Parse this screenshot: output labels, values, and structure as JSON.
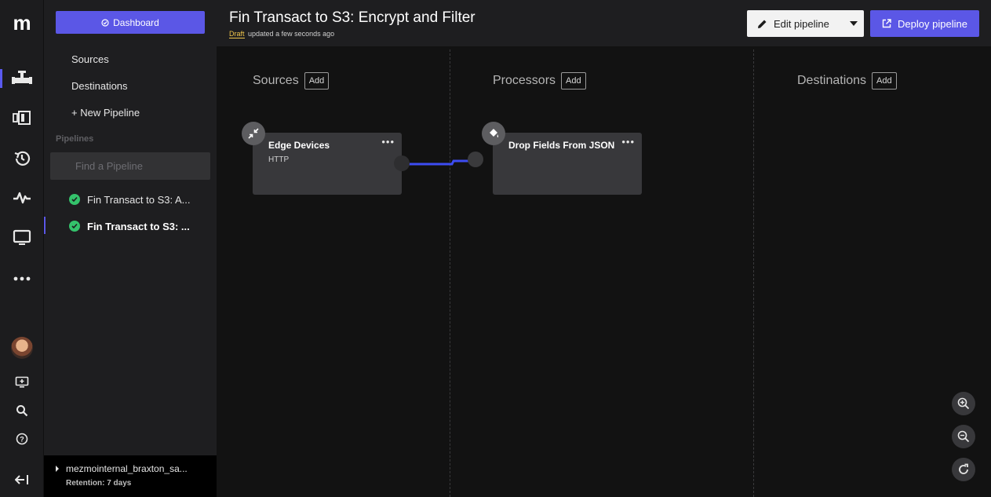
{
  "app": {
    "logo": "m"
  },
  "rail": {
    "items": [
      {
        "icon": "pipeline-icon",
        "active": true
      },
      {
        "icon": "columns-icon"
      },
      {
        "icon": "history-icon"
      },
      {
        "icon": "pulse-icon"
      },
      {
        "icon": "monitor-icon"
      },
      {
        "icon": "more-icon"
      }
    ],
    "bottom": [
      "avatar",
      "add-screen-icon",
      "search-icon",
      "help-icon",
      "collapse-icon"
    ]
  },
  "sidebar": {
    "dashboard_label": "Dashboard",
    "links": [
      {
        "label": "Sources"
      },
      {
        "label": "Destinations"
      },
      {
        "label": "+ New Pipeline"
      }
    ],
    "pipelines_heading": "Pipelines",
    "find_placeholder": "Find a Pipeline",
    "pipelines": [
      {
        "label": "Fin Transact to S3: A...",
        "status": "ok",
        "active": false
      },
      {
        "label": "Fin Transact to S3: ...",
        "status": "ok",
        "active": true
      }
    ],
    "account": {
      "name": "mezmointernal_braxton_sa...",
      "retention": "Retention: 7 days"
    }
  },
  "header": {
    "title": "Fin Transact to S3: Encrypt and Filter",
    "draft_label": "Draft",
    "updated_text": "updated a few seconds ago",
    "edit_label": "Edit pipeline",
    "deploy_label": "Deploy pipeline"
  },
  "canvas": {
    "columns": [
      {
        "label": "Sources",
        "add_label": "Add"
      },
      {
        "label": "Processors",
        "add_label": "Add"
      },
      {
        "label": "Destinations",
        "add_label": "Add"
      }
    ],
    "nodes": [
      {
        "title": "Edge Devices",
        "subtitle": "HTTP",
        "icon": "compress-icon",
        "menu": "•••"
      },
      {
        "title": "Drop Fields From JSON",
        "subtitle": "",
        "icon": "paint-bucket-icon",
        "menu": "•••"
      }
    ],
    "connection_color": "#3d4cf2",
    "zoom_controls": [
      "zoom-in-icon",
      "zoom-out-icon",
      "reset-icon"
    ]
  },
  "colors": {
    "accent": "#5b57e6",
    "success": "#34c26b",
    "draft": "#f0c64c"
  }
}
